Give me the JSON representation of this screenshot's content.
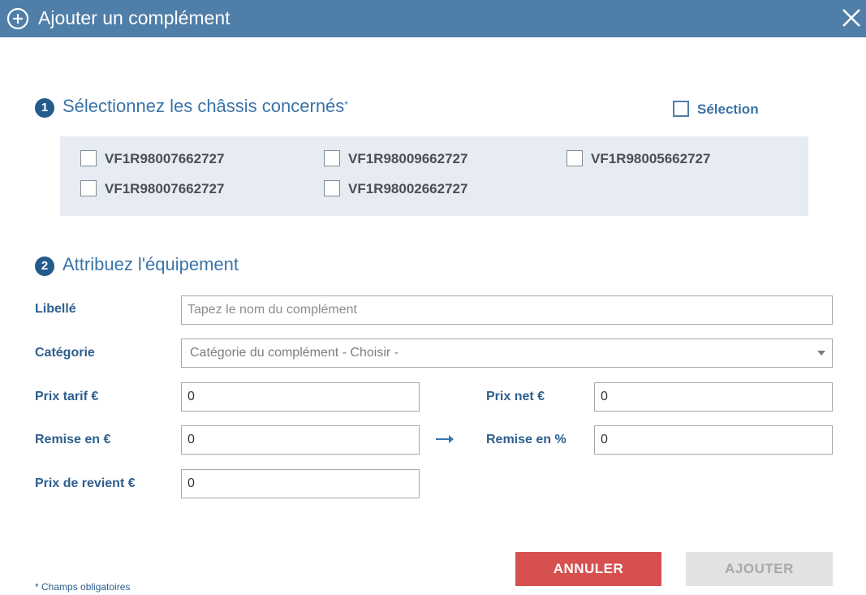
{
  "dialog": {
    "title": "Ajouter un complément",
    "icons": {
      "title": "plus-circle-icon",
      "close": "close-icon"
    },
    "colors": {
      "header": "#4f7ea8",
      "accent": "#3a74a8",
      "cancel": "#d65050",
      "disabled": "#e2e2e2",
      "panel": "#e7ecf3"
    }
  },
  "step1": {
    "number": "1",
    "title": "Sélectionnez les châssis concernés",
    "required_mark": "*",
    "select_all_label": "Sélection",
    "select_all_checked": false,
    "chassis": [
      {
        "label": "VF1R98007662727",
        "checked": false
      },
      {
        "label": "VF1R98009662727",
        "checked": false
      },
      {
        "label": "VF1R98005662727",
        "checked": false
      },
      {
        "label": "VF1R98007662727",
        "checked": false
      },
      {
        "label": "VF1R98002662727",
        "checked": false
      }
    ]
  },
  "step2": {
    "number": "2",
    "title": "Attribuez l'équipement",
    "fields": {
      "libelle": {
        "label": "Libellé",
        "placeholder": "Tapez le nom du complément",
        "value": ""
      },
      "categorie": {
        "label": "Catégorie",
        "value": "Catégorie du complément - Choisir -"
      },
      "prix_tarif": {
        "label": "Prix tarif €",
        "value": "0"
      },
      "prix_net": {
        "label": "Prix net €",
        "value": "0"
      },
      "remise_eur": {
        "label": "Remise en €",
        "value": "0"
      },
      "remise_pct": {
        "label": "Remise en %",
        "value": "0"
      },
      "prix_revient": {
        "label": "Prix de revient €",
        "value": "0"
      }
    },
    "arrow_icon": "arrow-right-icon"
  },
  "buttons": {
    "cancel": "ANNULER",
    "add": "AJOUTER"
  },
  "footnote": "* Champs obligatoires"
}
